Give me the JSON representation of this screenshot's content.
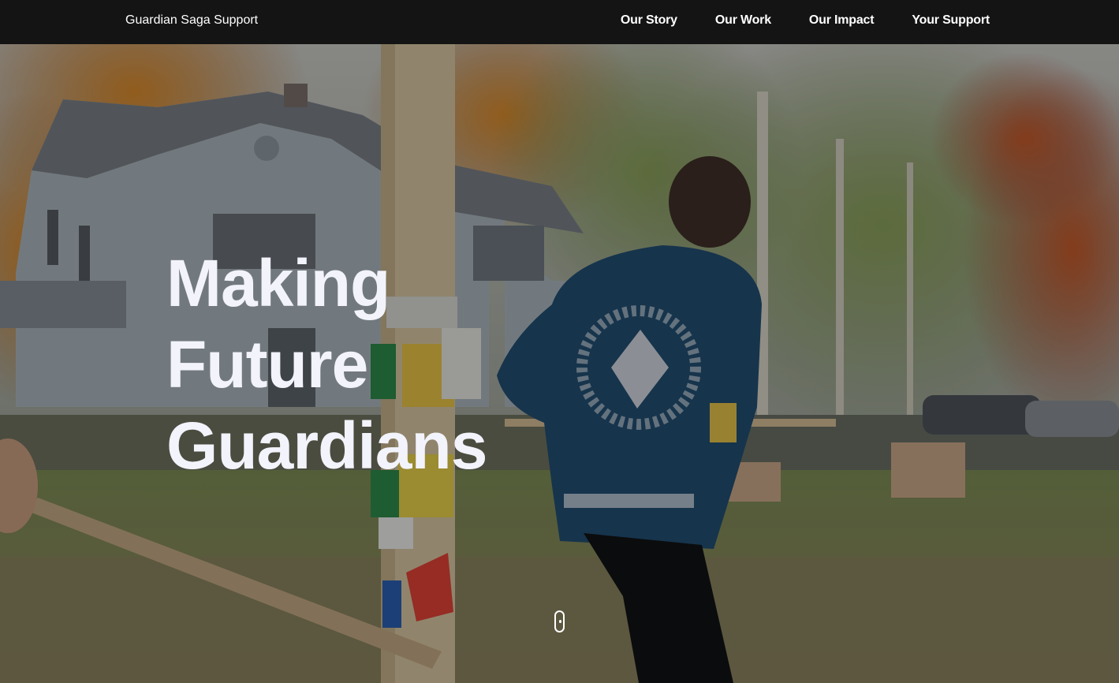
{
  "header": {
    "brand": "Guardian Saga Support",
    "nav": [
      "Our Story",
      "Our Work",
      "Our Impact",
      "Your Support"
    ]
  },
  "hero": {
    "title_lines": [
      "Making",
      "Future",
      "Guardians"
    ],
    "scroll_icon": "mouse-scroll-icon"
  },
  "colors": {
    "navbar": "#141414",
    "title": "#f2f3fb",
    "nav_text": "#ffffff"
  }
}
